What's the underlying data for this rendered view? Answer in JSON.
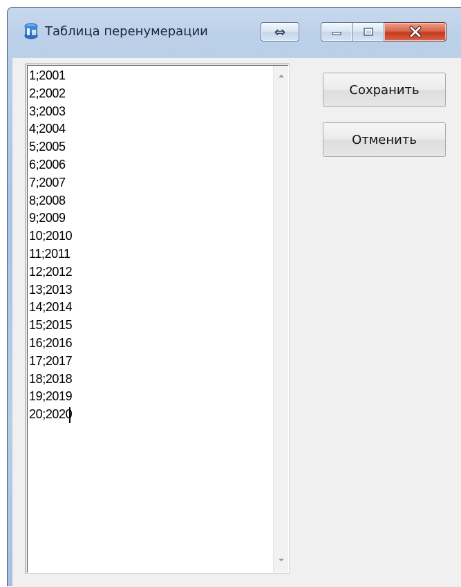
{
  "window": {
    "title": "Таблица перенумерации"
  },
  "titlebar_buttons": {
    "swap": "⇔",
    "minimize_icon": "minimize-icon",
    "maximize_icon": "maximize-icon",
    "close_icon": "close-icon"
  },
  "editor": {
    "lines": [
      "1;2001",
      "2;2002",
      "3;2003",
      "4;2004",
      "5;2005",
      "6;2006",
      "7;2007",
      "8;2008",
      "9;2009",
      "10;2010",
      "11;2011",
      "12;2012",
      "13;2013",
      "14;2014",
      "15;2015",
      "16;2016",
      "17;2017",
      "18;2018",
      "19;2019",
      "20;2020"
    ]
  },
  "actions": {
    "save_label": "Сохранить",
    "cancel_label": "Отменить"
  },
  "colors": {
    "close_button": "#c43a1c",
    "window_frame": "#a9c3e3",
    "client_bg": "#f0f0f0"
  }
}
